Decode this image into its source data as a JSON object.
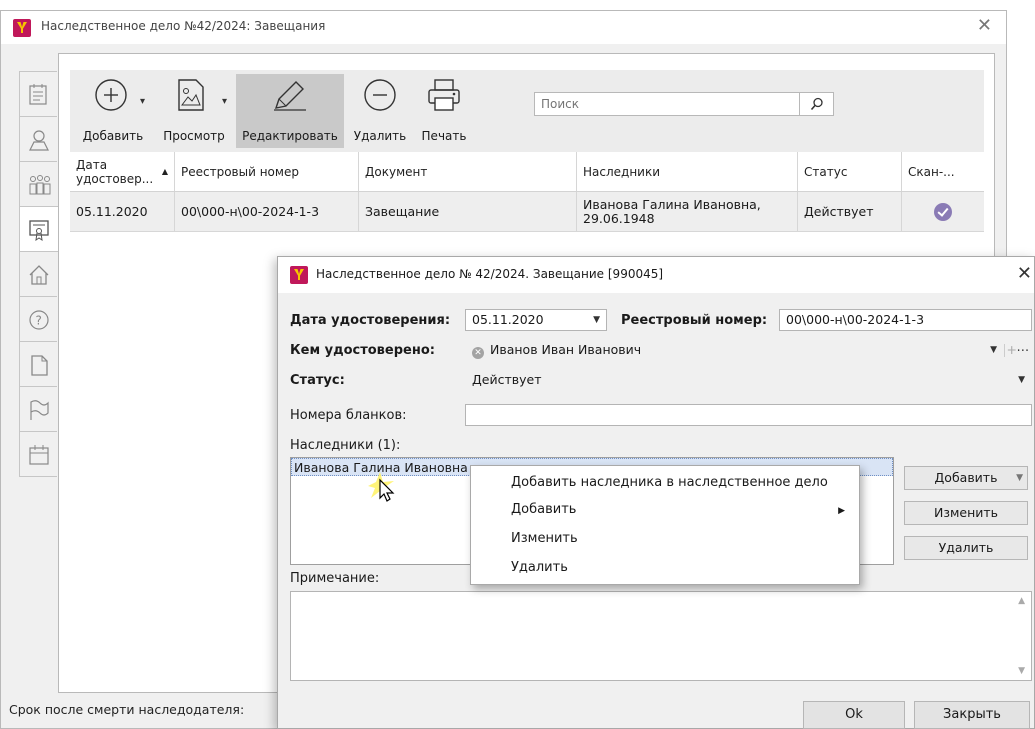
{
  "main_window": {
    "title": "Наследственное дело №42/2024: Завещания",
    "close_glyph": "✕"
  },
  "side_tabs": [
    {
      "name": "document-list-icon"
    },
    {
      "name": "person-icon"
    },
    {
      "name": "people-group-icon"
    },
    {
      "name": "certificate-icon",
      "active": true
    },
    {
      "name": "house-icon"
    },
    {
      "name": "question-icon"
    },
    {
      "name": "file-icon"
    },
    {
      "name": "flag-icon"
    },
    {
      "name": "calendar-icon"
    }
  ],
  "toolbar": {
    "add_label": "Добавить",
    "view_label": "Просмотр",
    "edit_label": "Редактировать",
    "delete_label": "Удалить",
    "print_label": "Печать",
    "search_placeholder": "Поиск"
  },
  "grid": {
    "columns": [
      "Дата удостовер...",
      "Реестровый номер",
      "Документ",
      "Наследники",
      "Статус",
      "Скан-..."
    ],
    "rows": [
      {
        "date": "05.11.2020",
        "reg_number": "00\\000-н\\00-2024-1-3",
        "document": "Завещание",
        "heirs": "Иванова Галина Ивановна, 29.06.1948",
        "status": "Действует",
        "scan": "check"
      }
    ]
  },
  "status_bar": {
    "label": "Срок после смерти наследодателя:"
  },
  "dialog": {
    "title": "Наследственное дело № 42/2024. Завещание [990045]",
    "close_glyph": "✕",
    "date_label": "Дата удостоверения:",
    "date_value": "05.11.2020",
    "reg_label": "Реестровый номер:",
    "reg_value": "00\\000-н\\00-2024-1-3",
    "certified_by_label": "Кем удостоверено:",
    "certified_by_value": "Иванов Иван Иванович",
    "status_label": "Статус:",
    "status_value": "Действует",
    "forms_label": "Номера бланков:",
    "forms_value": "",
    "heirs_label": "Наследники (1):",
    "heirs_item": "Иванова Галина Ивановна",
    "add_button": "Добавить",
    "edit_button": "Изменить",
    "delete_button": "Удалить",
    "note_label": "Примечание:",
    "note_value": "",
    "ok_button": "Ok",
    "close_button": "Закрыть"
  },
  "context_menu": {
    "items": [
      "Добавить наследника в наследственное дело",
      "Добавить",
      "Изменить",
      "Удалить"
    ]
  },
  "colors": {
    "app_icon_bg": "#c0185a",
    "app_icon_fg": "#f6c600",
    "selected_row": "#eeeeee",
    "scan_badge": "#8a7bb5"
  }
}
